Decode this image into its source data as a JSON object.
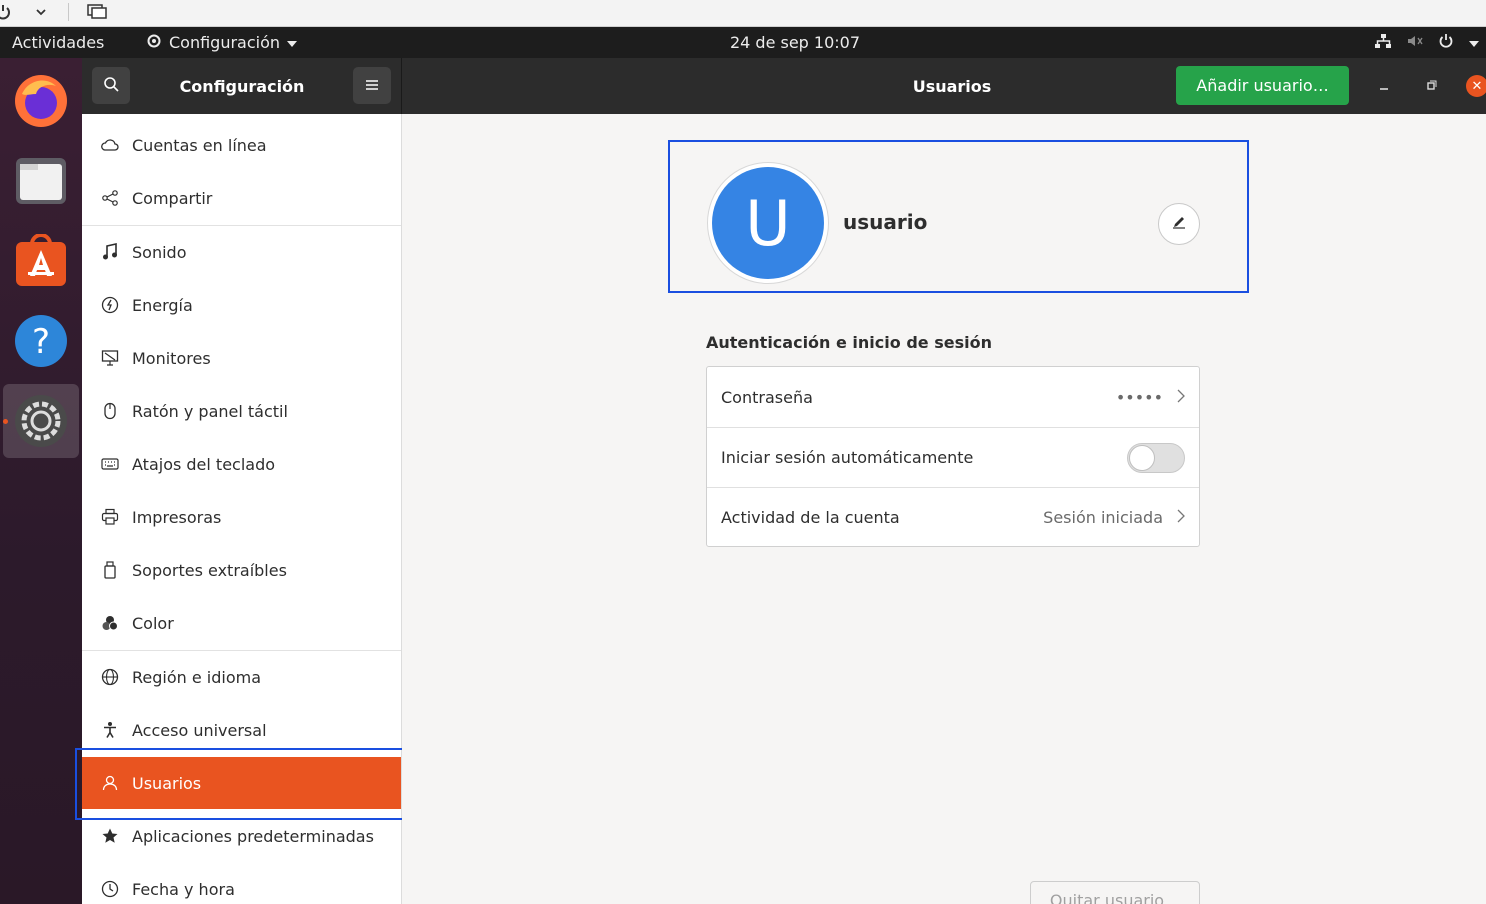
{
  "topbar": {
    "activities": "Actividades",
    "app_menu": "Configuración",
    "clock": "24 de sep  10:07"
  },
  "header": {
    "sidebar_title": "Configuración",
    "page_title": "Usuarios",
    "add_user": "Añadir usuario…"
  },
  "sidebar": {
    "items": [
      {
        "label": "Cuentas en línea",
        "icon": "cloud-icon"
      },
      {
        "label": "Compartir",
        "icon": "share-icon"
      },
      {
        "label": "Sonido",
        "icon": "music-note-icon"
      },
      {
        "label": "Energía",
        "icon": "power-icon"
      },
      {
        "label": "Monitores",
        "icon": "monitor-icon"
      },
      {
        "label": "Ratón y panel táctil",
        "icon": "mouse-icon"
      },
      {
        "label": "Atajos del teclado",
        "icon": "keyboard-icon"
      },
      {
        "label": "Impresoras",
        "icon": "printer-icon"
      },
      {
        "label": "Soportes extraíbles",
        "icon": "removable-media-icon"
      },
      {
        "label": "Color",
        "icon": "color-icon"
      },
      {
        "label": "Región e idioma",
        "icon": "globe-icon"
      },
      {
        "label": "Acceso universal",
        "icon": "accessibility-icon"
      },
      {
        "label": "Usuarios",
        "icon": "users-icon"
      },
      {
        "label": "Aplicaciones predeterminadas",
        "icon": "star-icon"
      },
      {
        "label": "Fecha y hora",
        "icon": "clock-icon"
      }
    ],
    "selected": "Usuarios"
  },
  "user": {
    "avatar_letter": "U",
    "name": "usuario"
  },
  "auth": {
    "section_title": "Autenticación e inicio de sesión",
    "rows": [
      {
        "label": "Contraseña",
        "value": "•••••"
      },
      {
        "label": "Iniciar sesión automáticamente",
        "toggle": false
      },
      {
        "label": "Actividad de la cuenta",
        "value": "Sesión iniciada"
      }
    ]
  },
  "footer": {
    "remove_user": "Quitar usuario…"
  },
  "colors": {
    "accent": "#e95420",
    "add_button": "#26a34a",
    "avatar": "#3584e4",
    "focus_outline": "#1a4fe0"
  }
}
